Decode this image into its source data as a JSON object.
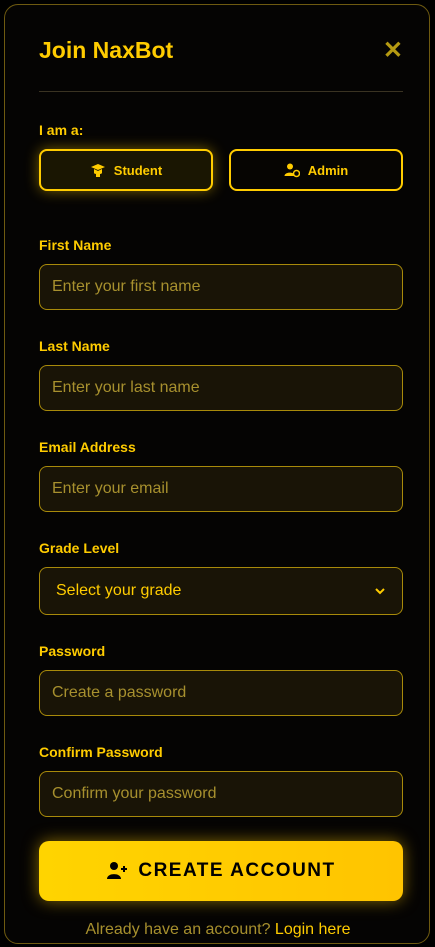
{
  "modal": {
    "title": "Join NaxBot"
  },
  "role": {
    "label": "I am a:",
    "options": [
      {
        "label": "Student",
        "icon": "graduation-cap-icon",
        "selected": true
      },
      {
        "label": "Admin",
        "icon": "user-shield-icon",
        "selected": false
      }
    ]
  },
  "form": {
    "first_name": {
      "label": "First Name",
      "placeholder": "Enter your first name"
    },
    "last_name": {
      "label": "Last Name",
      "placeholder": "Enter your last name"
    },
    "email": {
      "label": "Email Address",
      "placeholder": "Enter your email"
    },
    "grade": {
      "label": "Grade Level",
      "selected": "Select your grade"
    },
    "password": {
      "label": "Password",
      "placeholder": "Create a password"
    },
    "confirm_password": {
      "label": "Confirm Password",
      "placeholder": "Confirm your password"
    }
  },
  "actions": {
    "create_label": "CREATE ACCOUNT"
  },
  "footer": {
    "text": "Already have an account? ",
    "link": "Login here"
  },
  "colors": {
    "accent": "#ffcc00",
    "background": "#050403",
    "field_bg": "#191406"
  }
}
